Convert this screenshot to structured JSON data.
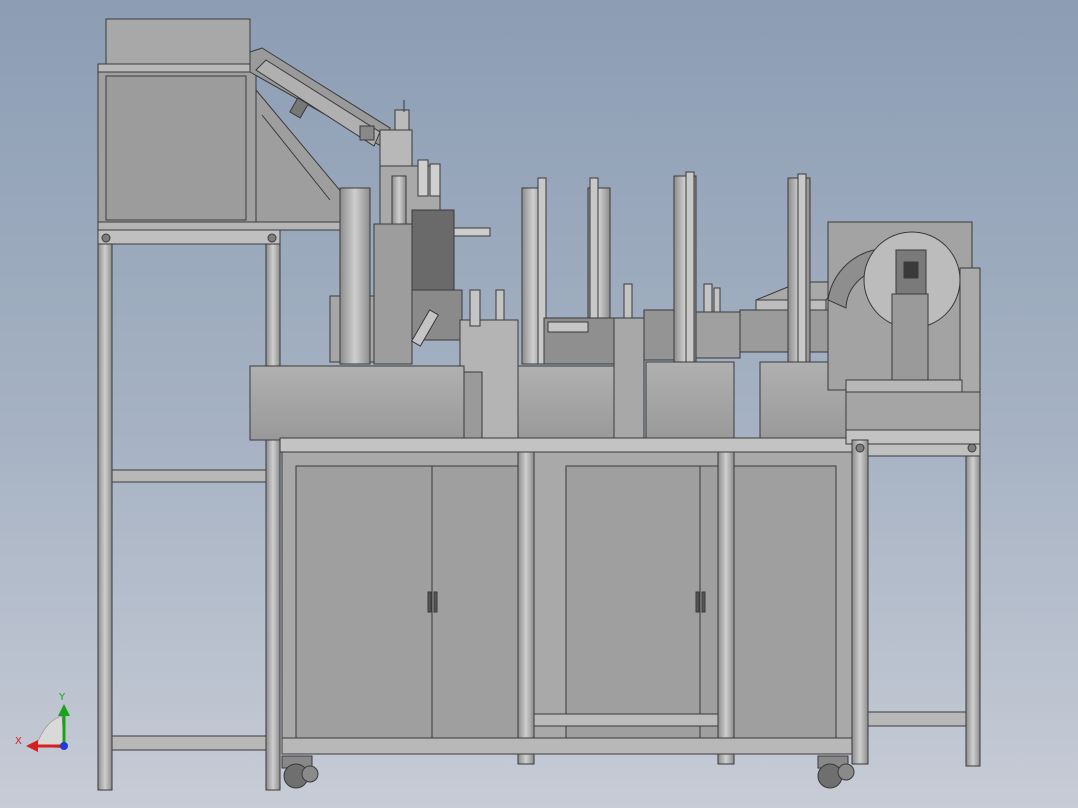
{
  "viewport": {
    "background_top": "#8c9db4",
    "background_bottom": "#c7ccd6"
  },
  "triad": {
    "x_label": "X",
    "y_label": "Y",
    "x_color": "#d61f1f",
    "y_color": "#1aa31a",
    "z_color": "#1f3ad6"
  },
  "model": {
    "body_color": "#a3a3a3",
    "frame_color": "#9a9a9a",
    "edge_color": "#3a3a3a",
    "dark_color": "#555555"
  }
}
